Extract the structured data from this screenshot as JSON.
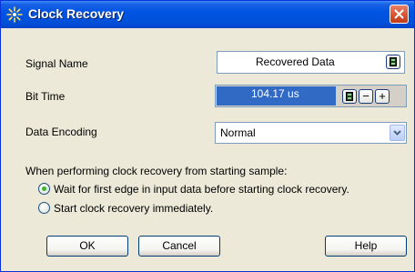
{
  "window": {
    "title": "Clock Recovery",
    "close_icon": "close-icon",
    "title_icon": "clock-recovery-icon"
  },
  "fields": {
    "signal_name": {
      "label": "Signal Name",
      "value": "Recovered Data",
      "icon": "calculator-icon"
    },
    "bit_time": {
      "label": "Bit Time",
      "value": "104.17 us",
      "icon": "calculator-icon",
      "minus": "−",
      "plus": "+"
    },
    "data_encoding": {
      "label": "Data Encoding",
      "value": "Normal",
      "icon": "chevron-down-icon"
    }
  },
  "recovery": {
    "prompt": "When performing clock recovery from starting sample:",
    "options": [
      {
        "label": "Wait for first edge in input data before starting clock recovery.",
        "selected": true
      },
      {
        "label": "Start clock recovery immediately.",
        "selected": false
      }
    ]
  },
  "buttons": {
    "ok": "OK",
    "cancel": "Cancel",
    "help": "Help"
  }
}
